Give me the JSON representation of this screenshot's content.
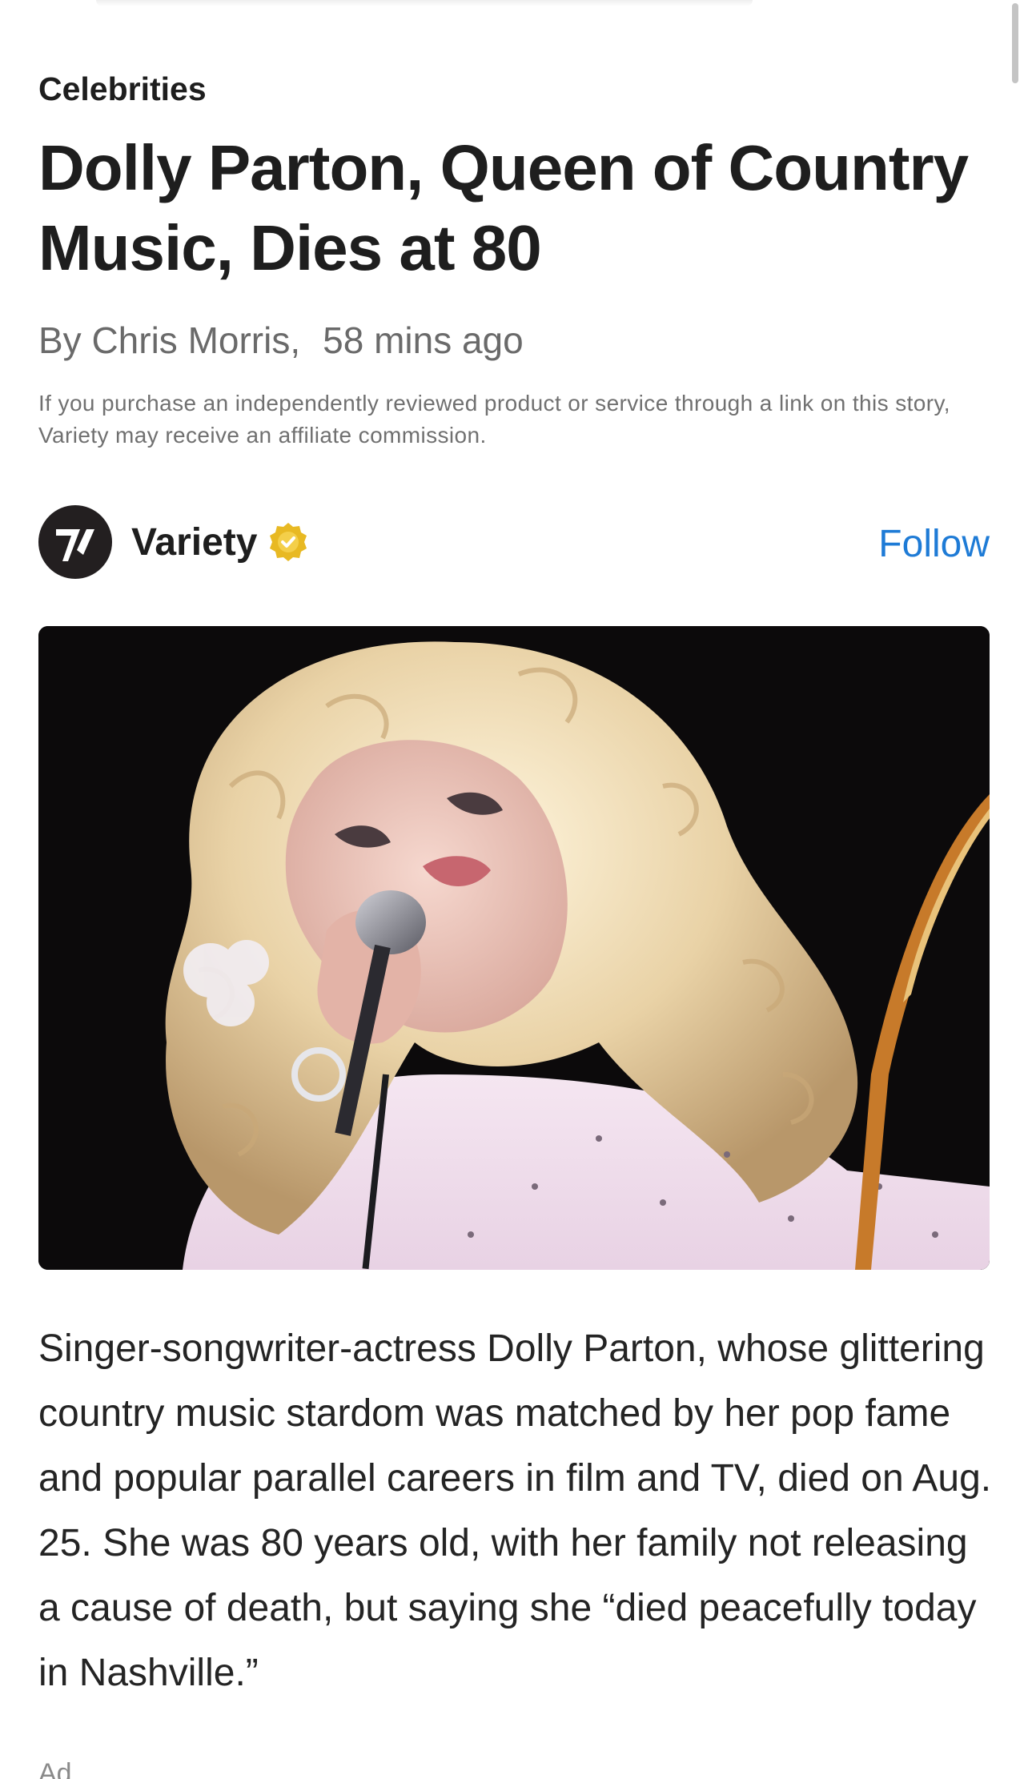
{
  "article": {
    "category": "Celebrities",
    "headline": "Dolly Parton, Queen of Country Music, Dies at 80",
    "author": "By Chris Morris,",
    "time_ago": "58 mins ago",
    "disclaimer": "If you purchase an independently reviewed product or service through a link on this story, Variety may receive an affiliate commission.",
    "body": "Singer-songwriter-actress Dolly Parton, whose glittering country music stardom was matched by her pop fame and popular parallel careers in film and TV, died on Aug. 25. She was 80 years old, with her family not releasing a cause of death, but saying she “died peacefully today in Nashville.”"
  },
  "publisher": {
    "name": "Variety",
    "logo_icon": "variety-v-logo",
    "verified_icon": "verified-badge-icon",
    "verified_color": "#e8b923",
    "follow_label": "Follow",
    "follow_color": "#1e7bd6"
  },
  "hero_image": {
    "icon": "photo-singer-with-microphone"
  },
  "ad": {
    "label": "Ad",
    "menu_icon": "more-dots-icon",
    "menu_glyph": "•••"
  }
}
